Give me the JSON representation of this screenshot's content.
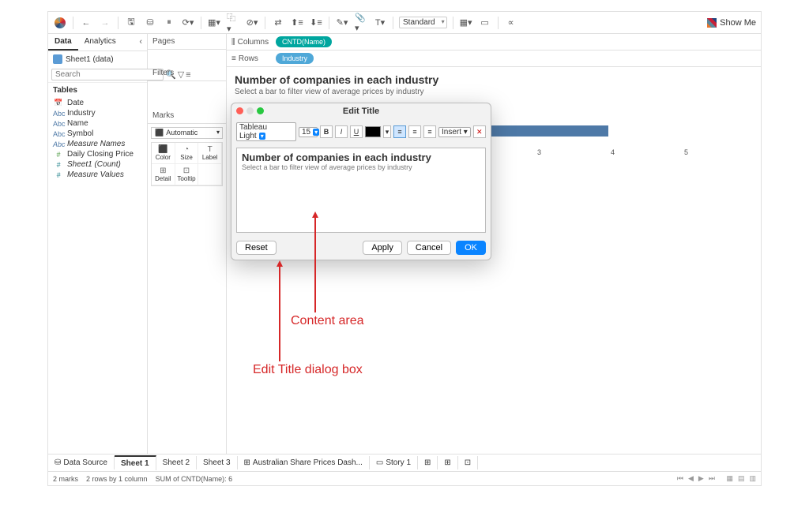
{
  "toolbar": {
    "fit_mode": "Standard",
    "showme": "Show Me"
  },
  "sidebar": {
    "tabs": [
      "Data",
      "Analytics"
    ],
    "datasource": "Sheet1 (data)",
    "search_placeholder": "Search",
    "tables_header": "Tables",
    "fields": [
      {
        "icon": "📅",
        "cls": "c-blue",
        "label": "Date"
      },
      {
        "icon": "Abc",
        "cls": "c-blue",
        "label": "Industry"
      },
      {
        "icon": "Abc",
        "cls": "c-blue",
        "label": "Name"
      },
      {
        "icon": "Abc",
        "cls": "c-blue",
        "label": "Symbol"
      },
      {
        "icon": "Abc",
        "cls": "c-blue italic",
        "label": "Measure Names"
      },
      {
        "icon": "#",
        "cls": "c-green",
        "label": "Daily Closing Price"
      },
      {
        "icon": "#",
        "cls": "c-teal italic",
        "label": "Sheet1 (Count)"
      },
      {
        "icon": "#",
        "cls": "c-teal italic",
        "label": "Measure Values"
      }
    ]
  },
  "shelves": {
    "pages": "Pages",
    "filters": "Filters",
    "marks": "Marks",
    "marks_type": "Automatic",
    "marks_cells": [
      "Color",
      "Size",
      "Label",
      "Detail",
      "Tooltip"
    ],
    "marks_icons": [
      "⬛",
      "◔",
      "T",
      "⊞",
      "⊡"
    ],
    "columns": "Columns",
    "rows": "Rows",
    "columns_pill": "CNTD(Name)",
    "rows_pill": "Industry"
  },
  "viz": {
    "title": "Number of companies in each industry",
    "subtitle": "Select a bar to filter view of average prices by industry",
    "axis_ticks": [
      "3",
      "4",
      "5"
    ]
  },
  "dialog": {
    "title": "Edit Title",
    "font": "Tableau Light",
    "size": "15",
    "insert": "Insert",
    "content_title": "Number of companies in each industry",
    "content_sub": "Select a bar to filter view of average prices by industry",
    "reset": "Reset",
    "apply": "Apply",
    "cancel": "Cancel",
    "ok": "OK"
  },
  "annotations": {
    "content_area": "Content area",
    "dialog_box": "Edit Title dialog box"
  },
  "bottom_tabs": {
    "data_source": "Data Source",
    "tabs": [
      "Sheet 1",
      "Sheet 2",
      "Sheet 3"
    ],
    "dash": "Australian Share Prices Dash...",
    "story": "Story 1"
  },
  "status": {
    "marks": "2 marks",
    "rows_by": "2 rows by 1 column",
    "sum": "SUM of CNTD(Name): 6"
  }
}
